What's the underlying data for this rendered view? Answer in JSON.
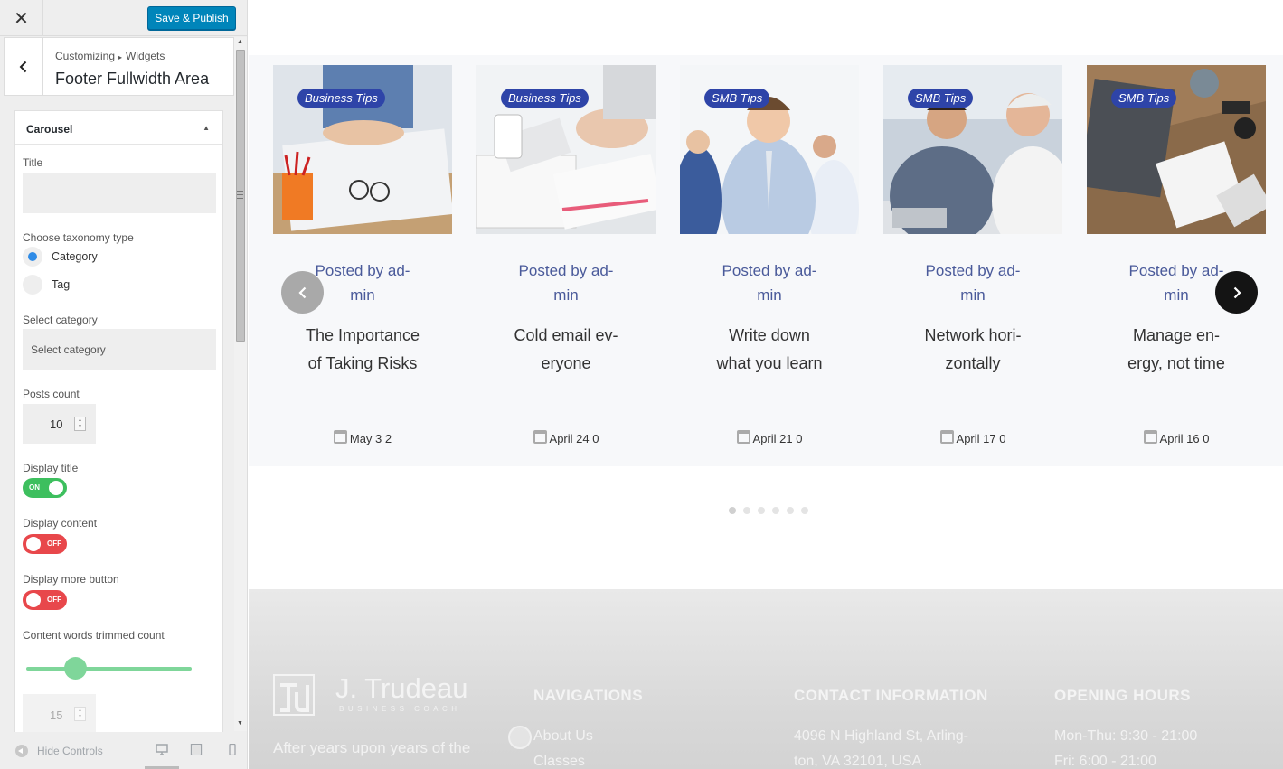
{
  "header": {
    "close_label": "✕",
    "save_label": "Save & Publish"
  },
  "panel": {
    "breadcrumb_root": "Customizing",
    "breadcrumb_sep": "▸",
    "breadcrumb_section": "Widgets",
    "title": "Footer Fullwidth Area"
  },
  "widget": {
    "name": "Carousel",
    "title_label": "Title",
    "title_value": "",
    "taxonomy_label": "Choose taxonomy type",
    "taxonomy_options": [
      {
        "label": "Category",
        "selected": true
      },
      {
        "label": "Tag",
        "selected": false
      }
    ],
    "category_label": "Select category",
    "category_value": "Select category",
    "posts_count_label": "Posts count",
    "posts_count": "10",
    "display_title_label": "Display title",
    "display_title": "ON",
    "display_content_label": "Display content",
    "display_content": "OFF",
    "display_more_label": "Display more button",
    "display_more": "OFF",
    "trim_label": "Content words trimmed count",
    "trim_slider_value": 15,
    "trim_count": "15"
  },
  "footer_bar": {
    "hide_controls": "Hide Controls",
    "devices": [
      "desktop-icon",
      "tablet-icon",
      "mobile-icon"
    ]
  },
  "carousel": {
    "posts": [
      {
        "tag": "Business Tips",
        "posted": [
          "Posted by ad-",
          "min"
        ],
        "title": [
          "The Importance",
          "of Taking Risks"
        ],
        "date": "May 3 2"
      },
      {
        "tag": "Business Tips",
        "posted": [
          "Posted by ad-",
          "min"
        ],
        "title": [
          "Cold email ev-",
          "eryone"
        ],
        "date": "April 24 0"
      },
      {
        "tag": "SMB Tips",
        "posted": [
          "Posted by ad-",
          "min"
        ],
        "title": [
          "Write down",
          "what you learn"
        ],
        "date": "April 21 0"
      },
      {
        "tag": "SMB Tips",
        "posted": [
          "Posted by ad-",
          "min"
        ],
        "title": [
          "Network hori-",
          "zontally"
        ],
        "date": "April 17 0"
      },
      {
        "tag": "SMB Tips",
        "posted": [
          "Posted by ad-",
          "min"
        ],
        "title": [
          "Manage en-",
          "ergy, not time"
        ],
        "date": "April 16 0"
      }
    ],
    "dots_count": 6,
    "active_dot": 0
  },
  "site_footer": {
    "logo_name": "J. Trudeau",
    "logo_sub": "BUSINESS COACH",
    "about_text": "After years upon years of the",
    "nav_heading": "NAVIGATIONS",
    "nav_items": [
      "About Us",
      "Classes"
    ],
    "contact_heading": "CONTACT INFORMATION",
    "contact_lines": [
      "4096 N Highland St, Arling-",
      "ton, VA 32101, USA"
    ],
    "hours_heading": "OPENING HOURS",
    "hours_lines": [
      "Mon-Thu: 9:30 - 21:00",
      "Fri: 6:00 - 21:00"
    ]
  },
  "colors": {
    "primary_button": "#0085ba",
    "tag_bg": "#2e44a8",
    "toggle_on": "#3dbf5e",
    "toggle_off": "#e8474b",
    "radio_selected": "#2f8be6",
    "slider": "#7fd69a"
  }
}
